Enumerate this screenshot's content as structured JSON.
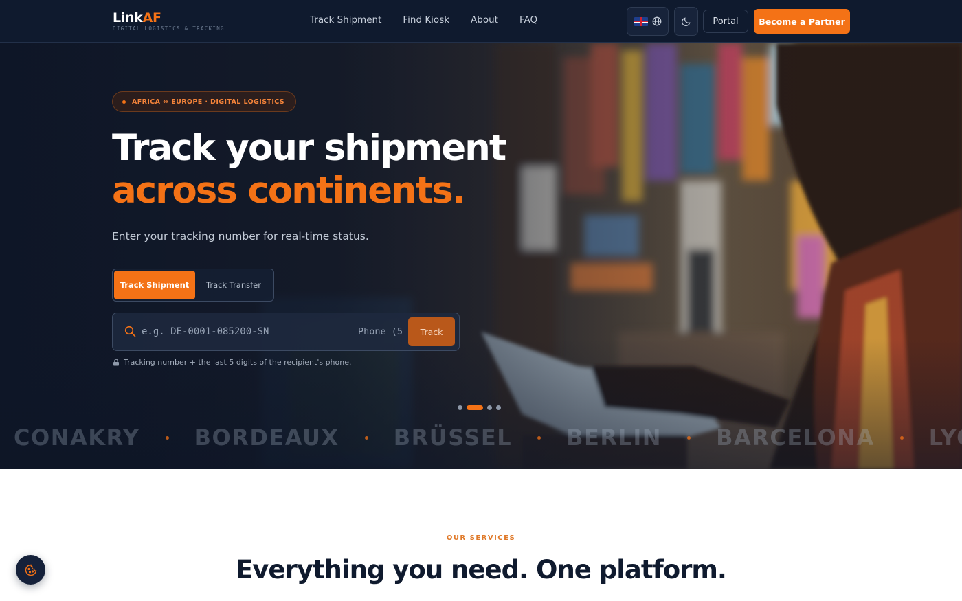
{
  "brand": {
    "name_main": "Link",
    "name_accent": "AF",
    "tagline": "DIGITAL LOGISTICS & TRACKING",
    "accent_color": "#f47216"
  },
  "nav": {
    "links": [
      {
        "label": "Track Shipment"
      },
      {
        "label": "Find Kiosk"
      },
      {
        "label": "About"
      },
      {
        "label": "FAQ"
      }
    ],
    "language_icon": "uk-flag-icon",
    "globe_icon": "globe-icon",
    "theme_icon": "moon-icon",
    "portal_label": "Portal",
    "partner_label": "Become a Partner"
  },
  "hero": {
    "eyebrow": "AFRICA ⇔ EUROPE · DIGITAL LOGISTICS",
    "title_line1": "Track your shipment",
    "title_line2": "across continents.",
    "subtitle": "Enter your tracking number for real-time status.",
    "tabs": [
      {
        "label": "Track Shipment",
        "active": true
      },
      {
        "label": "Track Transfer",
        "active": false
      }
    ],
    "search": {
      "placeholder": "e.g. DE-0001-085200-SN",
      "value": "",
      "phone_placeholder": "Phone (5",
      "button_label": "Track"
    },
    "hint": "Tracking number + the last 5 digits of the recipient's phone.",
    "carousel": {
      "count": 4,
      "active_index": 1
    },
    "cities": [
      "CONAKRY",
      "BORDEAUX",
      "BRÜSSEL",
      "BERLIN",
      "BARCELONA",
      "LYON"
    ]
  },
  "services": {
    "eyebrow": "OUR SERVICES",
    "title": "Everything you need. One platform."
  },
  "cookie": {
    "icon": "cookie-icon"
  }
}
